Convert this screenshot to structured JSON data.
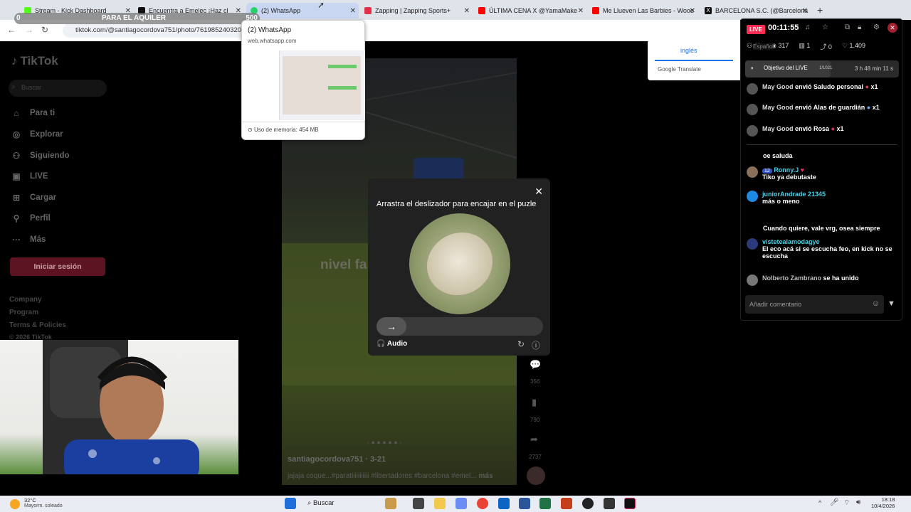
{
  "overlay": {
    "left_num": "0",
    "title": "PARA EL AQUILER",
    "right_num": "500"
  },
  "tabs": [
    {
      "label": "Stream - Kick Dashboard",
      "color": "#53fc18"
    },
    {
      "label": "Encuentra a Emelec ¡Haz cl",
      "color": "#111111"
    },
    {
      "label": "(2) WhatsApp",
      "color": "#25d366"
    },
    {
      "label": "Zapping | Zapping Sports+",
      "color": "#e0304a"
    },
    {
      "label": "ÚLTIMA CENA X @YamaMake",
      "color": "#ff0000"
    },
    {
      "label": "Me Llueven Las Barbies - Wooo",
      "color": "#ff0000"
    },
    {
      "label": "BARCELONA S.C. (@Barcelona",
      "color": "#111111"
    }
  ],
  "url": "tiktok.com/@santiagocordova751/photo/761985240320",
  "whatsapp_popup": {
    "title": "(2) WhatsApp",
    "domain": "web.whatsapp.com",
    "memory": "Uso de memoria: 454 MB"
  },
  "translate": {
    "tab": "inglés",
    "brand": "Google Translate",
    "extra": "Español"
  },
  "tiktok": {
    "logo": "TikTok",
    "search_placeholder": "Buscar",
    "menu": [
      {
        "label": "Para ti",
        "icon": "home-icon"
      },
      {
        "label": "Explorar",
        "icon": "compass-icon"
      },
      {
        "label": "Siguiendo",
        "icon": "users-icon"
      },
      {
        "label": "LIVE",
        "icon": "live-icon"
      },
      {
        "label": "Cargar",
        "icon": "plus-icon"
      },
      {
        "label": "Perfil",
        "icon": "user-icon"
      },
      {
        "label": "Más",
        "icon": "more-icon"
      }
    ],
    "login": "Iniciar sesión",
    "footer": [
      "Company",
      "Program",
      "Terms & Policies",
      "© 2026 TikTok"
    ],
    "video_text": "nivel fa",
    "author": "santiagocordova751",
    "date": "3-21",
    "caption": "jajaja coque...#paratiiiiiiiiiii #libertadores #barcelona #emel...",
    "more": "más",
    "comments": "356",
    "saves": "790",
    "shares": "2737"
  },
  "captcha": {
    "title": "Arrastra el deslizador para encajar en el puzle",
    "audio": "Audio"
  },
  "live": {
    "badge": "LIVE",
    "timer": "00:11:55",
    "stats": {
      "viewers": "11",
      "views": "317",
      "gifts": "1",
      "shares": "0",
      "likes": "1.409"
    },
    "goal_label": "Objetivo del LIVE",
    "goal_progress": "1/1021",
    "goal_time": "3 h 48 min 11 s",
    "gifts_feed": [
      {
        "user": "May Good",
        "text": "envió Saludo personal",
        "count": "x1",
        "color": "#e03a5a"
      },
      {
        "user": "May Good",
        "text": "envió Alas de guardián",
        "count": "x1",
        "color": "#6aa8ff"
      },
      {
        "user": "May Good",
        "text": "envió Rosa",
        "count": "x1",
        "color": "#e0306a"
      }
    ],
    "chat": [
      {
        "user": "",
        "text": "oe saluda"
      },
      {
        "user": "Ronny.J",
        "level": "12",
        "text": "Tiko ya debutaste"
      },
      {
        "user": "juniorAndrade 21345",
        "text": "más o meno"
      },
      {
        "user": "",
        "text": "Cuando quiere, vale vrg, osea siempre"
      },
      {
        "user": "vistetealamodagye",
        "text": "El eco acá si se escucha feo, en kick no se escucha"
      },
      {
        "user": "Nolberto Zambrano",
        "text": "se ha unido"
      }
    ],
    "comment_placeholder": "Añadir comentario"
  },
  "taskbar": {
    "weather_temp": "32°C",
    "weather_desc": "Mayorm. soleado",
    "search": "Buscar",
    "time": "18:18",
    "date": "10/4/2026"
  }
}
